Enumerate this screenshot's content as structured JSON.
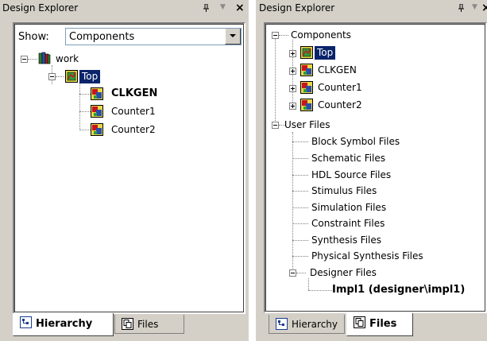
{
  "left_panel": {
    "title": "Design Explorer",
    "pin_glyph": "ꟷ",
    "close_glyph": "×",
    "show_label": "Show:",
    "show_value": "Components",
    "tree": {
      "root": "work",
      "top": "Top",
      "children": [
        "CLKGEN",
        "Counter1",
        "Counter2"
      ]
    },
    "tabs": {
      "hierarchy": "Hierarchy",
      "files": "Files",
      "active": "hierarchy"
    }
  },
  "right_panel": {
    "title": "Design Explorer",
    "tree": {
      "components": "Components",
      "component_items": [
        "Top",
        "CLKGEN",
        "Counter1",
        "Counter2"
      ],
      "user_files": "User Files",
      "file_items": [
        "Block Symbol Files",
        "Schematic Files",
        "HDL Source Files",
        "Stimulus Files",
        "Simulation Files",
        "Constraint Files",
        "Synthesis Files",
        "Physical Synthesis Files"
      ],
      "designer_files": "Designer Files",
      "impl": "Impl1 (designer\\impl1)"
    },
    "tabs": {
      "hierarchy": "Hierarchy",
      "files": "Files",
      "active": "files"
    }
  },
  "colors": {
    "panel_bg": "#d4d0c8",
    "selection": "#0a246a",
    "tree_bg": "#ffffff"
  }
}
